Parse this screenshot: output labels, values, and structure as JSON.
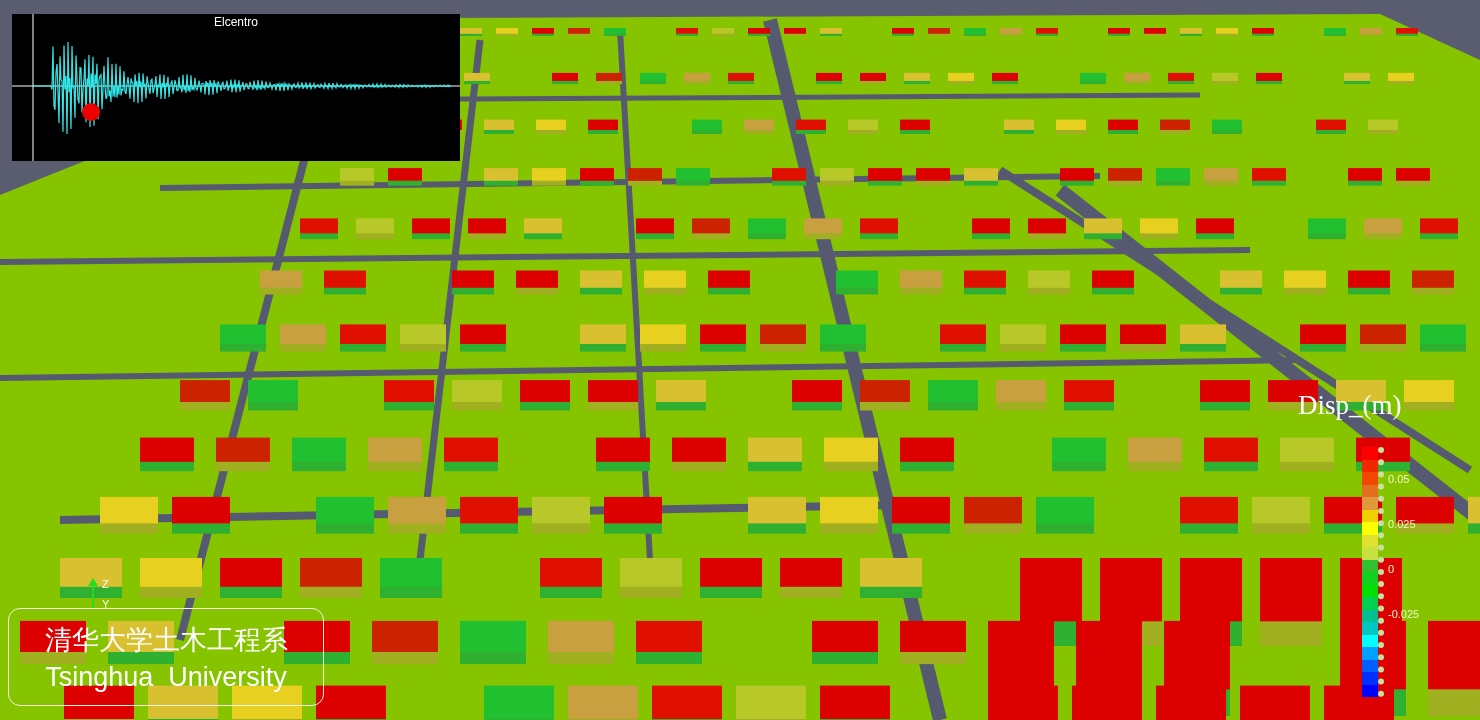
{
  "viewport": {
    "inset_plot": {
      "title": "Elcentro"
    },
    "legend": {
      "title": "Disp_(m)",
      "ticks": [
        "0.05",
        "0.025",
        "0",
        "-0.025"
      ]
    },
    "axis_labels": [
      "Z",
      "Y"
    ],
    "logo": {
      "chinese": "清华大学土木工程系",
      "english": "Tsinghua  University"
    }
  }
}
